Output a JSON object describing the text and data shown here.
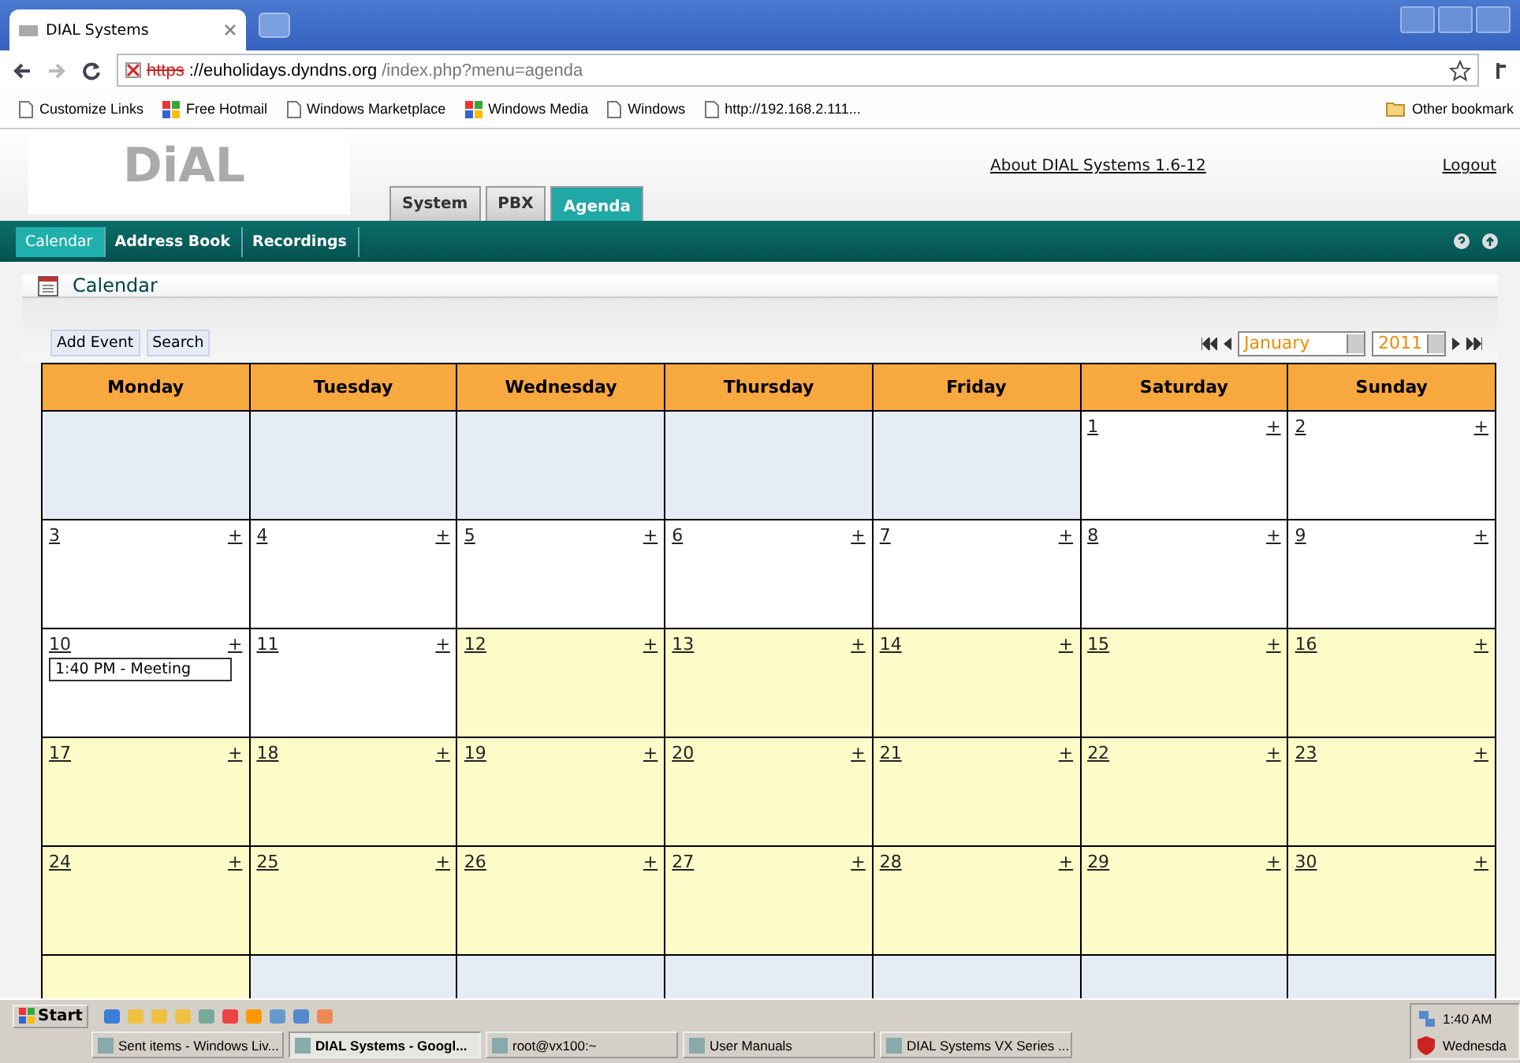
{
  "browser": {
    "tab_title": "DIAL Systems",
    "url_scheme": "https",
    "url_host": "://euholidays.dyndns.org",
    "url_path": "/index.php?menu=agenda",
    "bookmarks": [
      {
        "label": "Customize Links",
        "kind": "page"
      },
      {
        "label": "Free Hotmail",
        "kind": "windows"
      },
      {
        "label": "Windows Marketplace",
        "kind": "page"
      },
      {
        "label": "Windows Media",
        "kind": "windows"
      },
      {
        "label": "Windows",
        "kind": "page"
      },
      {
        "label": "http://192.168.2.111...",
        "kind": "page"
      }
    ],
    "other_bookmarks": "Other bookmark"
  },
  "header": {
    "logo": "DiAL",
    "tabs": [
      {
        "label": "System",
        "selected": false
      },
      {
        "label": "PBX",
        "selected": false
      },
      {
        "label": "Agenda",
        "selected": true
      }
    ],
    "about_link": "About DIAL Systems 1.6-12",
    "logout_link": "Logout"
  },
  "nav": [
    {
      "label": "Calendar",
      "selected": true
    },
    {
      "label": "Address Book",
      "selected": false
    },
    {
      "label": "Recordings",
      "selected": false
    }
  ],
  "panel_title": "Calendar",
  "toolbar": {
    "buttons": [
      "Add Event",
      "Search"
    ],
    "month": "January",
    "year": "2011"
  },
  "calendar": {
    "weekdays": [
      "Monday",
      "Tuesday",
      "Wednesday",
      "Thursday",
      "Friday",
      "Saturday",
      "Sunday"
    ],
    "add_mark": "+",
    "weeks": [
      [
        {
          "kind": "empty"
        },
        {
          "kind": "empty"
        },
        {
          "kind": "empty"
        },
        {
          "kind": "empty"
        },
        {
          "kind": "empty"
        },
        {
          "kind": "past",
          "day": "1"
        },
        {
          "kind": "past",
          "day": "2"
        }
      ],
      [
        {
          "kind": "past",
          "day": "3"
        },
        {
          "kind": "past",
          "day": "4"
        },
        {
          "kind": "past",
          "day": "5"
        },
        {
          "kind": "past",
          "day": "6"
        },
        {
          "kind": "past",
          "day": "7"
        },
        {
          "kind": "past",
          "day": "8"
        },
        {
          "kind": "past",
          "day": "9"
        }
      ],
      [
        {
          "kind": "past",
          "day": "10",
          "events": [
            "1:40 PM - Meeting"
          ]
        },
        {
          "kind": "past",
          "day": "11"
        },
        {
          "kind": "upcoming",
          "day": "12"
        },
        {
          "kind": "upcoming",
          "day": "13"
        },
        {
          "kind": "upcoming",
          "day": "14"
        },
        {
          "kind": "upcoming",
          "day": "15"
        },
        {
          "kind": "upcoming",
          "day": "16"
        }
      ],
      [
        {
          "kind": "upcoming",
          "day": "17"
        },
        {
          "kind": "upcoming",
          "day": "18"
        },
        {
          "kind": "upcoming",
          "day": "19"
        },
        {
          "kind": "upcoming",
          "day": "20"
        },
        {
          "kind": "upcoming",
          "day": "21"
        },
        {
          "kind": "upcoming",
          "day": "22"
        },
        {
          "kind": "upcoming",
          "day": "23"
        }
      ],
      [
        {
          "kind": "upcoming",
          "day": "24"
        },
        {
          "kind": "upcoming",
          "day": "25"
        },
        {
          "kind": "upcoming",
          "day": "26"
        },
        {
          "kind": "upcoming",
          "day": "27"
        },
        {
          "kind": "upcoming",
          "day": "28"
        },
        {
          "kind": "upcoming",
          "day": "29"
        },
        {
          "kind": "upcoming",
          "day": "30"
        }
      ],
      [
        {
          "kind": "upcoming"
        },
        {
          "kind": "empty"
        },
        {
          "kind": "empty"
        },
        {
          "kind": "empty"
        },
        {
          "kind": "empty"
        },
        {
          "kind": "empty"
        },
        {
          "kind": "empty"
        }
      ]
    ]
  },
  "taskbar": {
    "start": "Start",
    "windows": [
      {
        "label": "Sent items - Windows Liv...",
        "selected": false
      },
      {
        "label": "DIAL Systems - Googl...",
        "selected": true
      },
      {
        "label": "root@vx100:~",
        "selected": false
      },
      {
        "label": "User Manuals",
        "selected": false
      },
      {
        "label": "DIAL Systems VX Series ...",
        "selected": false
      }
    ],
    "time": "1:40 AM",
    "day": "Wednesda"
  }
}
